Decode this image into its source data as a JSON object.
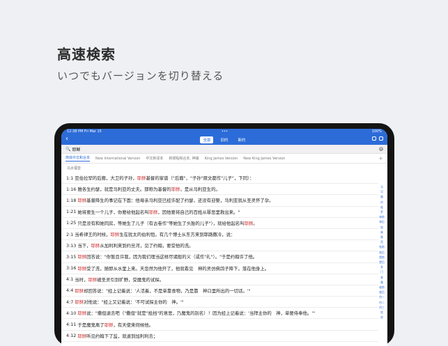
{
  "headline": "高速検索",
  "subheadline": "いつでもバージョンを切り替える",
  "status": {
    "time": "12:38 PM",
    "date": "Fri Mar 15",
    "dots": "•••",
    "battery": "100%"
  },
  "nav": {
    "back": "‹",
    "segments": [
      "全部",
      "旧约",
      "新约"
    ],
    "active_index": 0
  },
  "search": {
    "icon": "🔍",
    "query": "耶稣",
    "clear": "×"
  },
  "versions": {
    "items": [
      "简体中文和合本",
      "New International Version",
      "中文新译本",
      "新標點和合本, 神版",
      "King James Version",
      "New King James Version"
    ],
    "active_index": 0,
    "add": "+"
  },
  "section_label": "马太福音",
  "highlight_color": "#d23a3a",
  "results": [
    {
      "ref": "1:1",
      "parts": [
        "亚伯拉罕的后裔，大卫的子孙，",
        "耶稣",
        "基督的家谱（\"后裔\"，\"子孙\"原文都作\"儿子\"，下同）："
      ]
    },
    {
      "ref": "1:16",
      "parts": [
        "雅各生约瑟，就是马利亚的丈夫。那称为基督的",
        "耶稣",
        "，是从马利亚生的。"
      ]
    },
    {
      "ref": "1:18",
      "parts": [
        "",
        "耶稣",
        "基督降生的事记在下面：他母亲马利亚已经许配了约瑟，还没有迎娶，马利亚就从圣灵怀了孕。"
      ]
    },
    {
      "ref": "1:21",
      "parts": [
        "她将要生一个儿子，你要给他起名叫",
        "耶稣",
        "，因他要将自己的百姓从罪恶里救出来。\""
      ]
    },
    {
      "ref": "1:25",
      "parts": [
        "只是没有和她同房，等她生了儿子（有古卷作\"等她生了头胎的儿子\"），就给他起名叫",
        "耶稣",
        "。"
      ]
    },
    {
      "ref": "2:1",
      "parts": [
        "当希律王的时候，",
        "耶稣",
        "生在犹太的伯利恒。有几个博士从东方来到耶路撒冷，说："
      ]
    },
    {
      "ref": "3:13",
      "parts": [
        "当下，",
        "耶稣",
        "从加利利来到约旦河，见了约翰，要受他的洗。"
      ]
    },
    {
      "ref": "3:15",
      "parts": [
        "",
        "耶稣",
        "回答说：\"你暂且许我，因为我们理当这样尽诸般的义（或作\"礼\"）。\"于是约翰许了他。"
      ]
    },
    {
      "ref": "3:16",
      "parts": [
        "",
        "耶稣",
        "受了洗，随即从水里上来。天忽然为他开了，他就看见　神的灵仿佛鸽子降下，落在他身上。"
      ]
    },
    {
      "ref": "4:1",
      "parts": [
        "当时，",
        "耶稣",
        "被圣灵引到旷野，受魔鬼的试探。"
      ]
    },
    {
      "ref": "4:4",
      "parts": [
        "",
        "耶稣",
        "却回答说：\"经上记着说：'人活着，不是单靠食物，乃是靠　神口里所出的一切话。'\""
      ]
    },
    {
      "ref": "4:7",
      "parts": [
        "",
        "耶稣",
        "对他说：\"经上又记着说：'不可试探主你的　神。'\""
      ]
    },
    {
      "ref": "4:10",
      "parts": [
        "",
        "耶稣",
        "说：\"撒但退去吧（\"撒但\"就是\"抵挡\"的意思，乃魔鬼的别名）！因为经上记着说：'当拜主你的　神，单要侍奉他。'\""
      ]
    },
    {
      "ref": "4:11",
      "parts": [
        "于是魔鬼离了",
        "耶稣",
        "，有天使来伺候他。"
      ]
    },
    {
      "ref": "4:12",
      "parts": [
        "",
        "耶稣",
        "听见约翰下了监，就退到加利利去；"
      ]
    }
  ],
  "book_index": [
    "马",
    "可",
    "路",
    "约",
    "徒",
    "罗",
    "林前",
    "林后",
    "加",
    "弗",
    "腓",
    "西",
    "帖前",
    "帖后",
    "提前",
    "提后",
    "多",
    "门",
    "来",
    "雅",
    "彼前",
    "彼后",
    "约一",
    "约二",
    "约三",
    "犹",
    "启"
  ]
}
